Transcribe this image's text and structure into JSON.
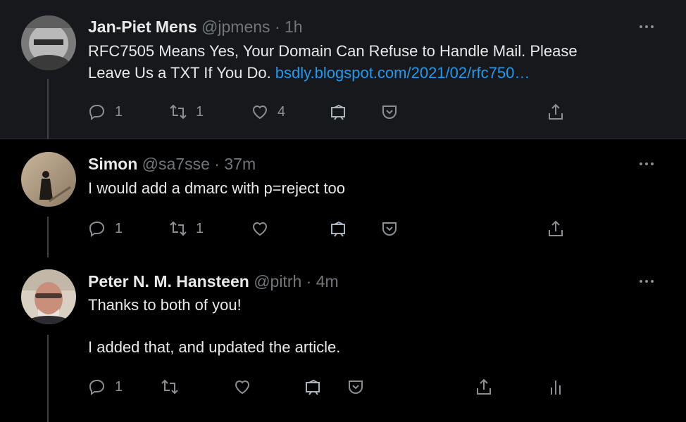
{
  "tweets": [
    {
      "name": "Jan-Piet Mens",
      "handle": "@jpmens",
      "time": "1h",
      "line1": "RFC7505 Means Yes, Your Domain Can Refuse to Handle Mail. Please",
      "line2_prefix": "Leave Us a TXT If You Do. ",
      "line2_link": "bsdly.blogspot.com/2021/02/rfc750…",
      "replies": "1",
      "retweets": "1",
      "likes": "4"
    },
    {
      "name": "Simon",
      "handle": "@sa7sse",
      "time": "37m",
      "line1": "I would add a dmarc with p=reject too",
      "replies": "1",
      "retweets": "1"
    },
    {
      "name": "Peter N. M. Hansteen",
      "handle": "@pitrh",
      "time": "4m",
      "line1": "Thanks to both of you!",
      "line2": "I added that, and updated the article.",
      "replies": "1"
    }
  ],
  "separator": "·",
  "colors": {
    "background": "#000000",
    "highlight": "#16181c",
    "link": "#1d9bf0",
    "muted": "#71767b"
  },
  "icons": [
    "reply-icon",
    "retweet-icon",
    "like-icon",
    "share-to-icon",
    "bookmark-icon",
    "share-icon",
    "analytics-icon",
    "more-icon"
  ]
}
